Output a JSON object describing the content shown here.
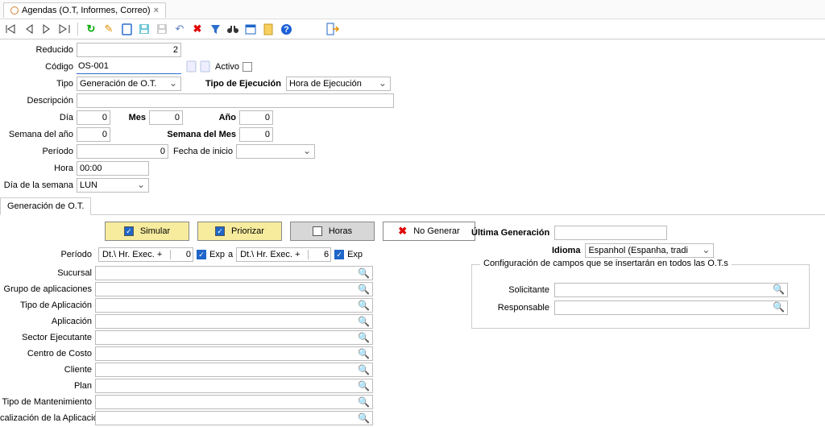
{
  "tab": {
    "title": "Agendas (O.T, Informes, Correo)"
  },
  "form": {
    "reducido_label": "Reducido",
    "reducido_value": "2",
    "codigo_label": "Código",
    "codigo_value": "OS-001",
    "activo_label": "Activo",
    "tipo_label": "Tipo",
    "tipo_value": "Generación de O.T.",
    "tipo_ejec_label": "Tipo de Ejecución",
    "tipo_ejec_value": "Hora de Ejecución",
    "descripcion_label": "Descripción",
    "dia_label": "Día",
    "dia_value": "0",
    "mes_label": "Mes",
    "mes_value": "0",
    "ano_label": "Año",
    "ano_value": "0",
    "semana_ano_label": "Semana del año",
    "semana_ano_value": "0",
    "semana_mes_label": "Semana del Mes",
    "semana_mes_value": "0",
    "periodo_label": "Período",
    "periodo_value": "0",
    "fecha_inicio_label": "Fecha de inicio",
    "hora_label": "Hora",
    "hora_value": "00:00",
    "dia_semana_label": "Día de la semana",
    "dia_semana_value": "LUN"
  },
  "subtab": "Generación de O.T.",
  "actions": {
    "simular": "Simular",
    "priorizar": "Priorizar",
    "horas": "Horas",
    "no_generar": "No Generar"
  },
  "right": {
    "ultima_generacion_label": "Última Generación",
    "idioma_label": "Idioma",
    "idioma_value": "Espanhol (Espanha, tradi",
    "fieldset_title": "Configuración de campos que se insertarán en todos las O.T.s",
    "solicitante_label": "Solicitante",
    "responsable_label": "Responsable"
  },
  "periodo_row": {
    "label": "Período",
    "from_text": "Dt.\\ Hr. Exec. +",
    "from_value": "0",
    "exp": "Exp",
    "a": "a",
    "to_text": "Dt.\\ Hr. Exec. +",
    "to_value": "6"
  },
  "lookups": [
    "Sucursal",
    "Grupo de aplicaciones",
    "Tipo de Aplicación",
    "Aplicación",
    "Sector Ejecutante",
    "Centro de Costo",
    "Cliente",
    "Plan",
    "Tipo de Mantenimiento",
    "calización de la Aplicación"
  ]
}
